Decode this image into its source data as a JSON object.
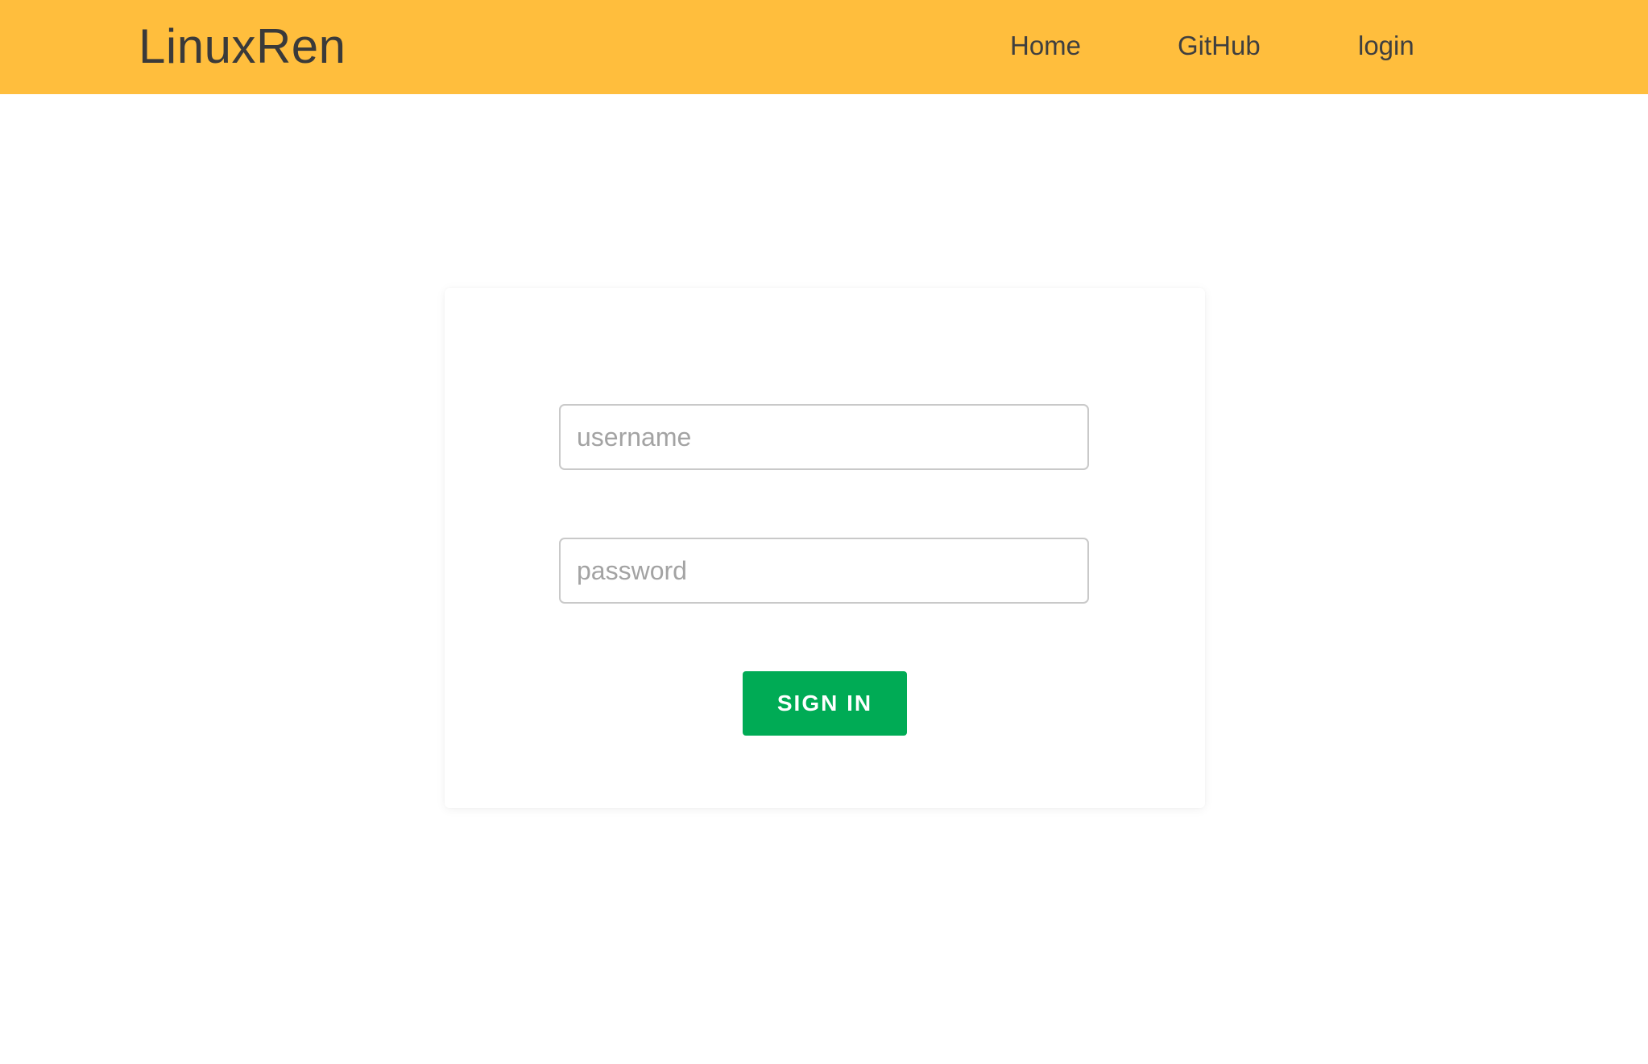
{
  "header": {
    "brand": "LinuxRen",
    "nav": [
      {
        "label": "Home"
      },
      {
        "label": "GitHub"
      },
      {
        "label": "login"
      }
    ]
  },
  "login_form": {
    "username_placeholder": "username",
    "password_placeholder": "password",
    "submit_label": "SIGN IN"
  },
  "colors": {
    "header_bg": "#ffbe3d",
    "button_bg": "#00ab55",
    "page_bg": "#ffffff"
  }
}
